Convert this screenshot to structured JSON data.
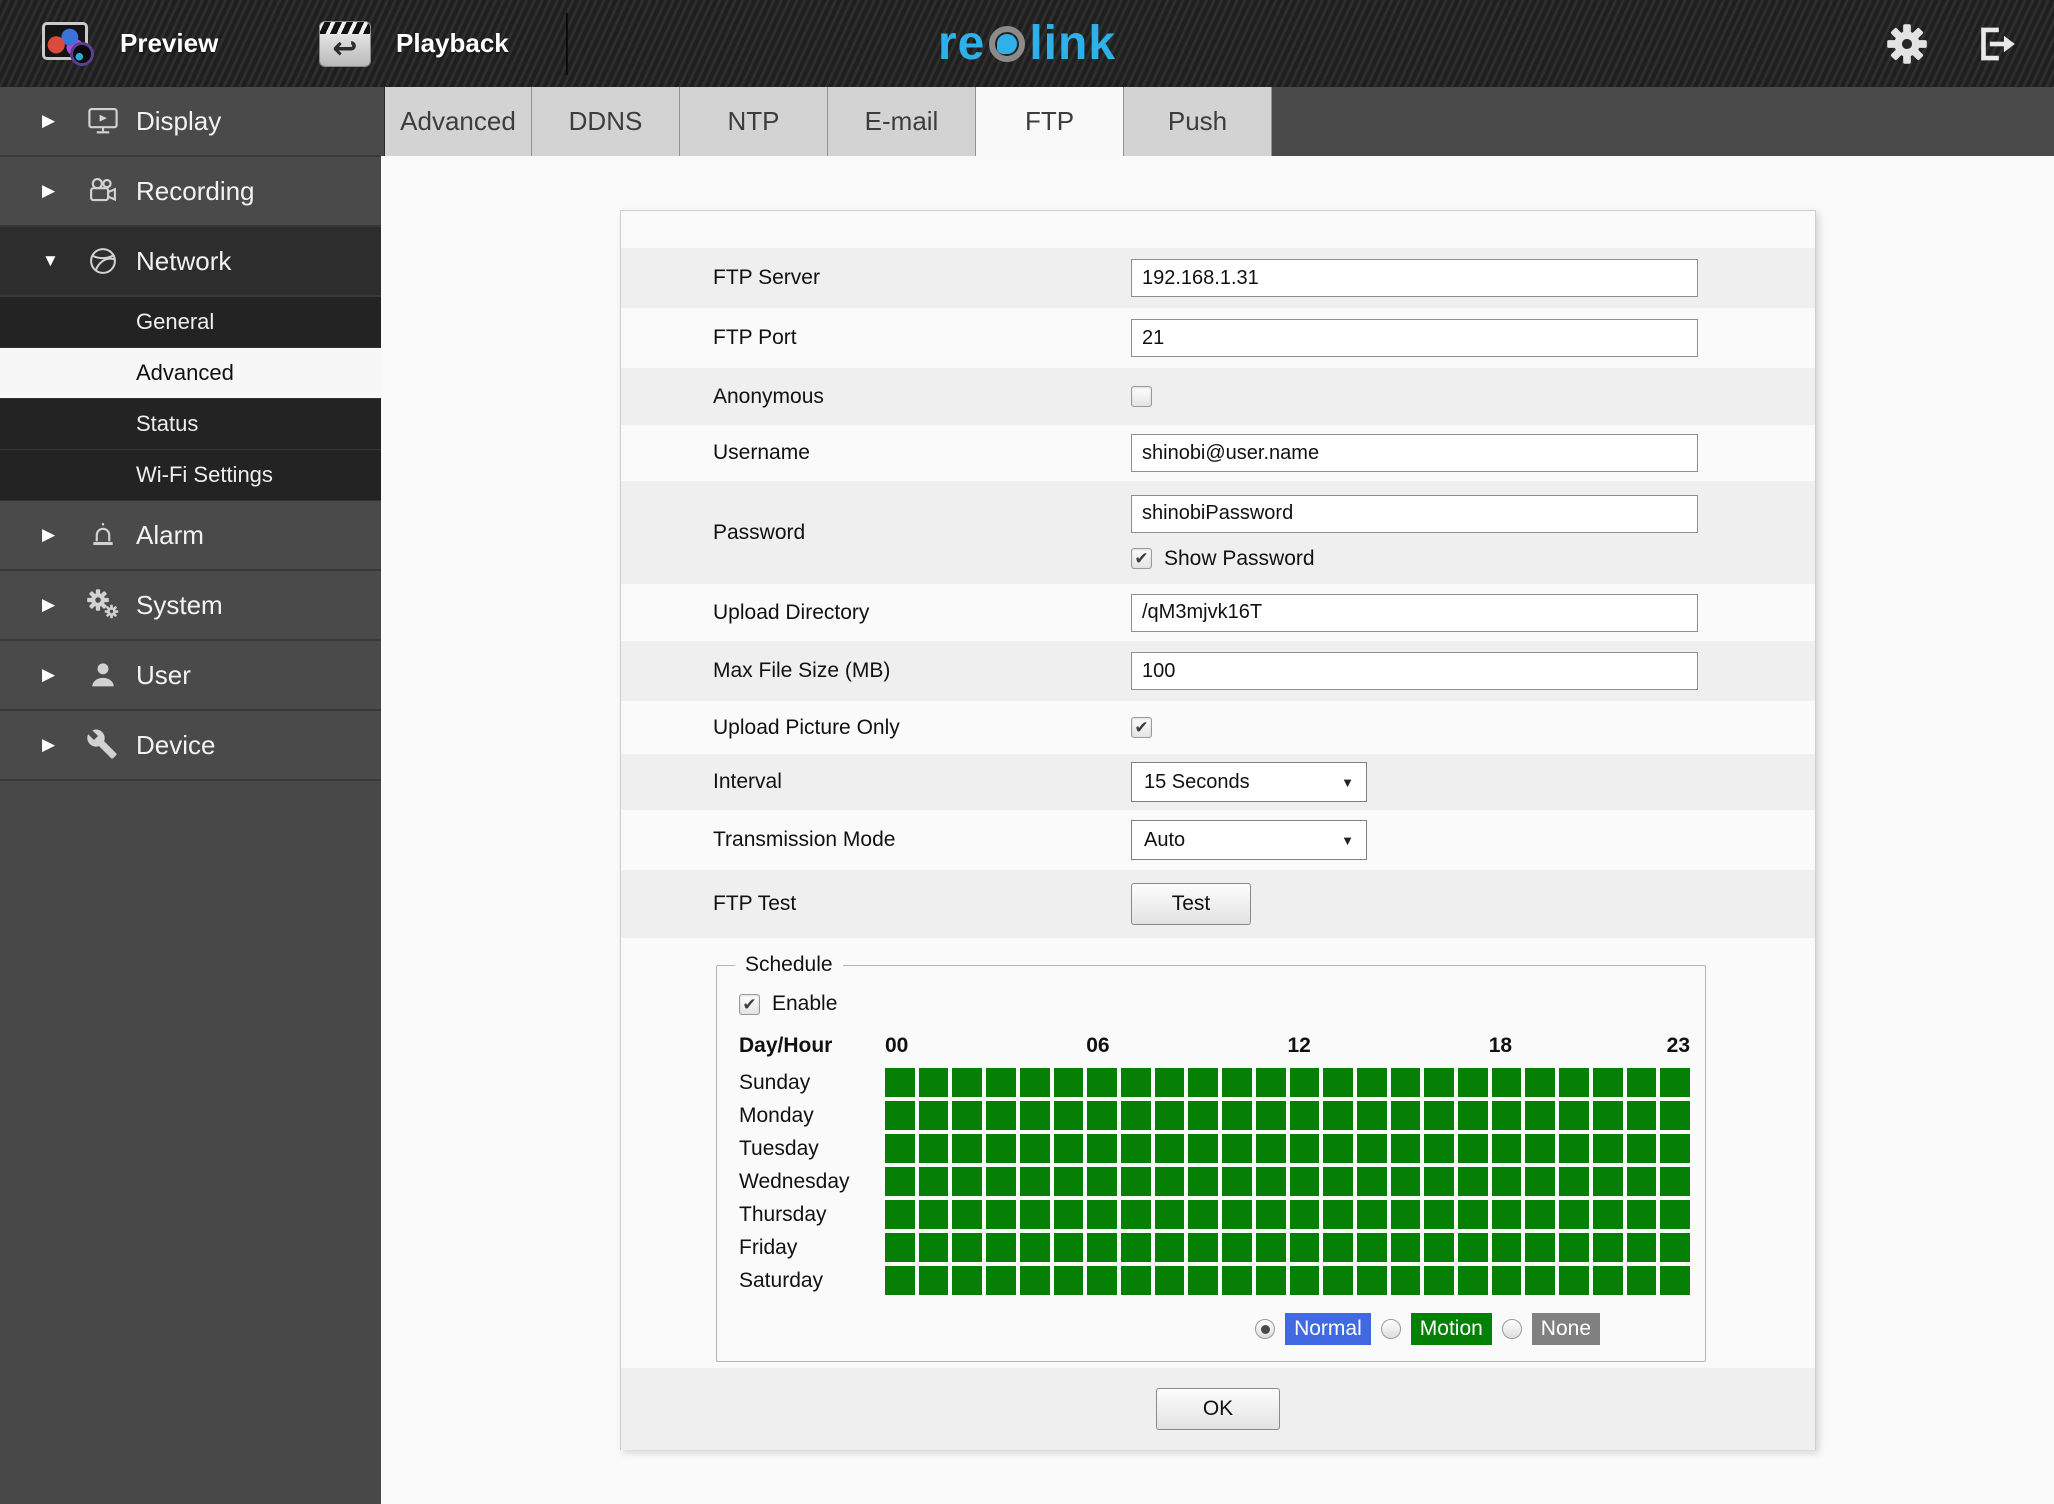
{
  "topbar": {
    "preview_label": "Preview",
    "playback_label": "Playback",
    "logo_pre": "re",
    "logo_post": "link",
    "brand_color": "#2fb0e8"
  },
  "sidebar": {
    "items": [
      {
        "label": "Display",
        "icon": "display-icon",
        "expanded": false
      },
      {
        "label": "Recording",
        "icon": "recording-icon",
        "expanded": false
      },
      {
        "label": "Network",
        "icon": "network-icon",
        "expanded": true
      },
      {
        "label": "Alarm",
        "icon": "alarm-icon",
        "expanded": false
      },
      {
        "label": "System",
        "icon": "system-icon",
        "expanded": false
      },
      {
        "label": "User",
        "icon": "user-icon",
        "expanded": false
      },
      {
        "label": "Device",
        "icon": "device-icon",
        "expanded": false
      }
    ],
    "network_children": [
      {
        "label": "General",
        "active": false
      },
      {
        "label": "Advanced",
        "active": true
      },
      {
        "label": "Status",
        "active": false
      },
      {
        "label": "Wi-Fi Settings",
        "active": false
      }
    ]
  },
  "tabs": {
    "items": [
      {
        "label": "Advanced",
        "active": false
      },
      {
        "label": "DDNS",
        "active": false
      },
      {
        "label": "NTP",
        "active": false
      },
      {
        "label": "E-mail",
        "active": false
      },
      {
        "label": "FTP",
        "active": true
      },
      {
        "label": "Push",
        "active": false
      }
    ]
  },
  "form": {
    "ftp_server": {
      "label": "FTP Server",
      "value": "192.168.1.31"
    },
    "ftp_port": {
      "label": "FTP Port",
      "value": "21"
    },
    "anonymous": {
      "label": "Anonymous",
      "checked": false
    },
    "username": {
      "label": "Username",
      "value": "shinobi@user.name"
    },
    "password": {
      "label": "Password",
      "value": "shinobiPassword",
      "show_password_label": "Show Password",
      "show_password_checked": true
    },
    "upload_directory": {
      "label": "Upload Directory",
      "value": "/qM3mjvk16T"
    },
    "max_file_size": {
      "label": "Max File Size (MB)",
      "value": "100"
    },
    "upload_picture_only": {
      "label": "Upload Picture Only",
      "checked": true
    },
    "interval": {
      "label": "Interval",
      "value": "15 Seconds"
    },
    "transmission_mode": {
      "label": "Transmission Mode",
      "value": "Auto"
    },
    "ftp_test": {
      "label": "FTP Test",
      "button_label": "Test"
    }
  },
  "schedule": {
    "legend": "Schedule",
    "enable_label": "Enable",
    "enable_checked": true,
    "day_hour_label": "Day/Hour",
    "hours": [
      "00",
      "06",
      "12",
      "18",
      "23"
    ],
    "days": [
      "Sunday",
      "Monday",
      "Tuesday",
      "Wednesday",
      "Thursday",
      "Friday",
      "Saturday"
    ],
    "columns": 24,
    "all_cells_on": true,
    "cell_color": "#058005",
    "modes": [
      {
        "label": "Normal",
        "color": "#4169e1",
        "selected": true
      },
      {
        "label": "Motion",
        "color": "#048004",
        "selected": false
      },
      {
        "label": "None",
        "color": "#808080",
        "selected": false
      }
    ]
  },
  "ok_label": "OK"
}
